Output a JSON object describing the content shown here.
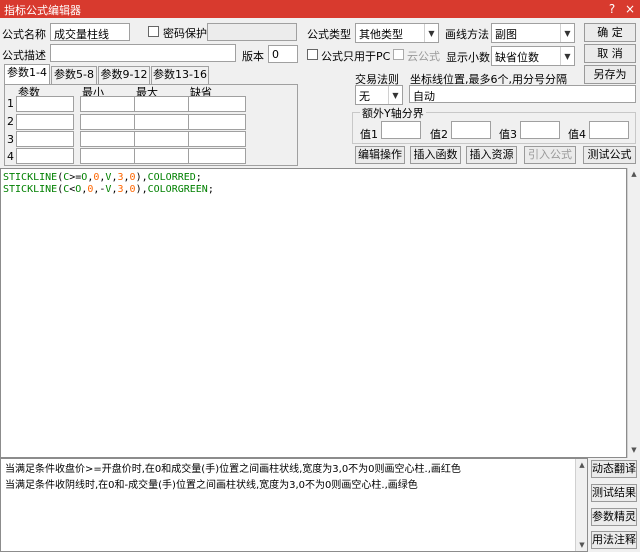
{
  "window": {
    "title": "指标公式编辑器",
    "help_icon": "?",
    "close_icon": "×"
  },
  "form": {
    "name_label": "公式名称",
    "name_value": "成交量柱线",
    "password_label": "密码保护",
    "password_value": "",
    "type_label": "公式类型",
    "type_value": "其他类型",
    "draw_label": "画线方法",
    "draw_value": "副图",
    "desc_label": "公式描述",
    "desc_value": "",
    "version_label": "版本",
    "version_value": "0",
    "pc_only_label": "公式只用于PC",
    "cloud_label": "云公式",
    "decimals_label": "显示小数",
    "decimals_value": "缺省位数"
  },
  "buttons": {
    "ok": "确 定",
    "cancel": "取 消",
    "save_as": "另存为"
  },
  "tabs": [
    "参数1-4",
    "参数5-8",
    "参数9-12",
    "参数13-16"
  ],
  "params": {
    "headers": [
      "参数",
      "最小",
      "最大",
      "缺省"
    ],
    "rows": [
      "1",
      "2",
      "3",
      "4"
    ]
  },
  "trade": {
    "rule_label": "交易法则",
    "rule_value": "无",
    "pos_label": "坐标线位置,最多6个,用分号分隔",
    "pos_value": "自动",
    "extra_label": "额外Y轴分界",
    "y_labels": [
      "值1",
      "值2",
      "值3",
      "值4"
    ]
  },
  "actions": [
    "编辑操作",
    "插入函数",
    "插入资源",
    "引入公式",
    "测试公式"
  ],
  "code": {
    "line1": [
      {
        "t": "STICKLINE",
        "c": "#008000"
      },
      {
        "t": "(",
        "c": "#000000"
      },
      {
        "t": "C",
        "c": "#008000"
      },
      {
        "t": ">=",
        "c": "#000000"
      },
      {
        "t": "O",
        "c": "#008000"
      },
      {
        "t": ",",
        "c": "#000000"
      },
      {
        "t": "0",
        "c": "#ff6600"
      },
      {
        "t": ",",
        "c": "#000000"
      },
      {
        "t": "V",
        "c": "#008000"
      },
      {
        "t": ",",
        "c": "#000000"
      },
      {
        "t": "3",
        "c": "#ff6600"
      },
      {
        "t": ",",
        "c": "#000000"
      },
      {
        "t": "0",
        "c": "#ff6600"
      },
      {
        "t": "),",
        "c": "#000000"
      },
      {
        "t": "COLORRED",
        "c": "#008000"
      },
      {
        "t": ";",
        "c": "#000000"
      }
    ],
    "line2": [
      {
        "t": "STICKLINE",
        "c": "#008000"
      },
      {
        "t": "(",
        "c": "#000000"
      },
      {
        "t": "C",
        "c": "#008000"
      },
      {
        "t": "<",
        "c": "#000000"
      },
      {
        "t": "O",
        "c": "#008000"
      },
      {
        "t": ",",
        "c": "#000000"
      },
      {
        "t": "0",
        "c": "#ff6600"
      },
      {
        "t": ",-",
        "c": "#000000"
      },
      {
        "t": "V",
        "c": "#008000"
      },
      {
        "t": ",",
        "c": "#000000"
      },
      {
        "t": "3",
        "c": "#ff6600"
      },
      {
        "t": ",",
        "c": "#000000"
      },
      {
        "t": "0",
        "c": "#ff6600"
      },
      {
        "t": "),",
        "c": "#000000"
      },
      {
        "t": "COLORGREEN",
        "c": "#008000"
      },
      {
        "t": ";",
        "c": "#000000"
      }
    ]
  },
  "notes": [
    "当满足条件收盘价>=开盘价时,在0和成交量(手)位置之间画柱状线,宽度为3,0不为0则画空心柱.,画红色",
    "当满足条件收阴线时,在0和-成交量(手)位置之间画柱状线,宽度为3,0不为0则画空心柱.,画绿色"
  ],
  "side_buttons": [
    "动态翻译",
    "测试结果",
    "参数精灵",
    "用法注释"
  ],
  "colors": {
    "titlebar": "#d83a2e",
    "keyword": "#008000",
    "number": "#ff6600"
  }
}
